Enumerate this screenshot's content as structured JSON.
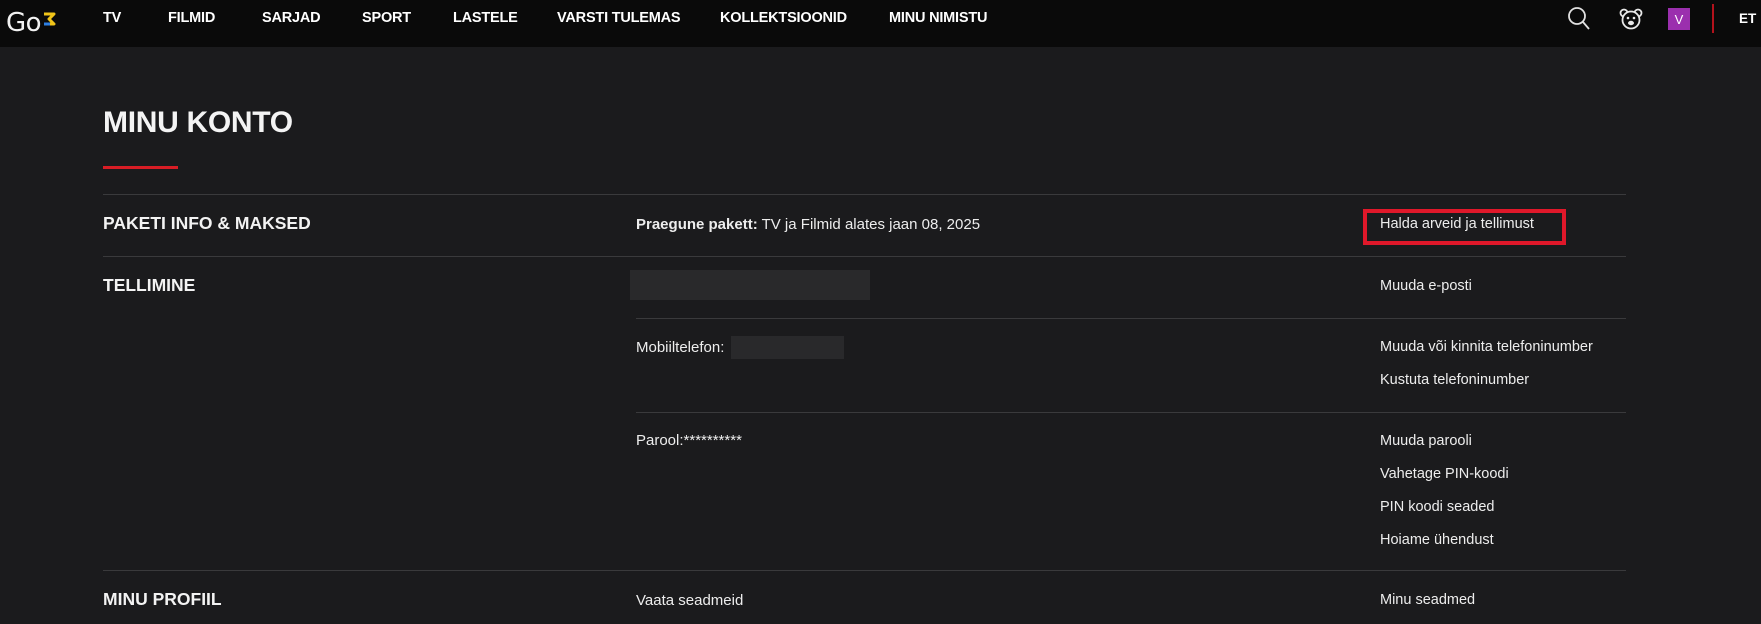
{
  "app": {
    "logo_text": "Go",
    "accent_color": "#d81d25",
    "logo_mark_color": "#f0c419"
  },
  "nav": {
    "items": [
      {
        "label": "TV"
      },
      {
        "label": "FILMID"
      },
      {
        "label": "SARJAD"
      },
      {
        "label": "SPORT"
      },
      {
        "label": "LASTELE"
      },
      {
        "label": "VARSTI TULEMAS"
      },
      {
        "label": "KOLLEKTSIOONID"
      },
      {
        "label": "MINU NIMISTU"
      }
    ],
    "search_icon": "search-icon",
    "kids_icon": "bear-face-icon",
    "avatar_initial": "V",
    "avatar_color": "#9b2fae",
    "language": "ET"
  },
  "page": {
    "title": "MINU KONTO"
  },
  "sections": {
    "package": {
      "label": "PAKETI INFO & MAKSED",
      "current_label": "Praegune pakett:",
      "current_value": " TV ja Filmid alates jaan 08, 2025",
      "action": "Halda arveid ja tellimust"
    },
    "subscription": {
      "label": "TELLIMINE",
      "email_action": "Muuda e-posti",
      "phone_label": "Mobiiltelefon:",
      "phone_actions": [
        "Muuda või kinnita telefoninumber",
        "Kustuta telefoninumber"
      ],
      "password_label": "Parool:",
      "password_value": "**********",
      "password_actions": [
        "Muuda parooli",
        "Vahetage PIN-koodi",
        "PIN koodi seaded",
        "Hoiame ühendust"
      ]
    },
    "profile": {
      "label": "MINU PROFIIL",
      "mid": "Vaata seadmeid",
      "action": "Minu seadmed"
    }
  }
}
